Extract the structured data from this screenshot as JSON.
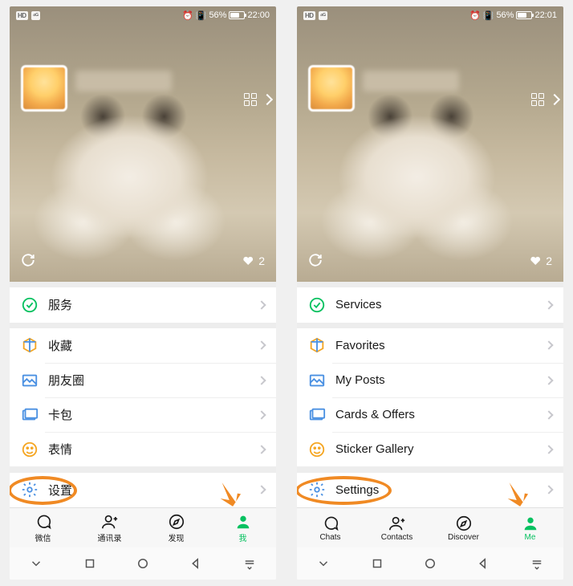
{
  "screens": [
    {
      "status": {
        "battery_pct": "56%",
        "time": "22:00"
      },
      "likes": "2",
      "menu": {
        "services": "服务",
        "favorites": "收藏",
        "posts": "朋友圈",
        "cards": "卡包",
        "stickers": "表情",
        "settings": "设置"
      },
      "tabs": {
        "chats": "微信",
        "contacts": "通讯录",
        "discover": "发现",
        "me": "我"
      }
    },
    {
      "status": {
        "battery_pct": "56%",
        "time": "22:01"
      },
      "likes": "2",
      "menu": {
        "services": "Services",
        "favorites": "Favorites",
        "posts": "My Posts",
        "cards": "Cards & Offers",
        "stickers": "Sticker Gallery",
        "settings": "Settings"
      },
      "tabs": {
        "chats": "Chats",
        "contacts": "Contacts",
        "discover": "Discover",
        "me": "Me"
      }
    }
  ],
  "colors": {
    "accent": "#07c160",
    "highlight": "#f08a24"
  }
}
